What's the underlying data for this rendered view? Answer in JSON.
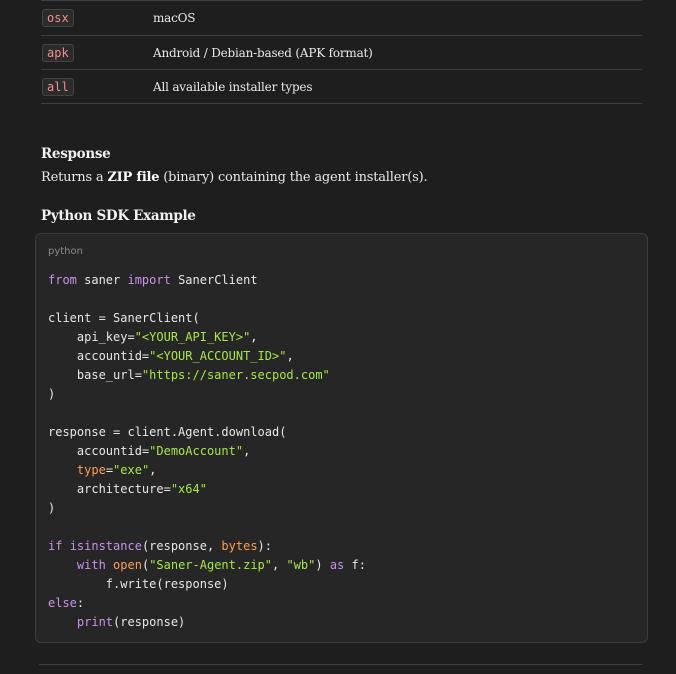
{
  "table": {
    "rows": [
      {
        "code": "osx",
        "desc": "macOS"
      },
      {
        "code": "apk",
        "desc": "Android / Debian-based (APK format)"
      },
      {
        "code": "all",
        "desc": "All available installer types"
      }
    ]
  },
  "response": {
    "heading": "Response",
    "text_before": "Returns a ",
    "text_bold": "ZIP file",
    "text_after": " (binary) containing the agent installer(s)."
  },
  "example": {
    "heading": "Python SDK Example",
    "language": "python",
    "lines": [
      [
        [
          "kw",
          "from"
        ],
        [
          "",
          " saner "
        ],
        [
          "kw",
          "import"
        ],
        [
          "",
          " SanerClient"
        ]
      ],
      [],
      [
        [
          "",
          "client = SanerClient("
        ]
      ],
      [
        [
          "",
          "    api_key="
        ],
        [
          "str",
          "\"<YOUR_API_KEY>\""
        ],
        [
          "",
          ","
        ]
      ],
      [
        [
          "",
          "    accountid="
        ],
        [
          "str",
          "\"<YOUR_ACCOUNT_ID>\""
        ],
        [
          "",
          ","
        ]
      ],
      [
        [
          "",
          "    base_url="
        ],
        [
          "str",
          "\"https://saner.secpod.com\""
        ]
      ],
      [
        [
          "",
          ")"
        ]
      ],
      [],
      [
        [
          "",
          "response = client.Agent.download("
        ]
      ],
      [
        [
          "",
          "    accountid="
        ],
        [
          "str",
          "\"DemoAccount\""
        ],
        [
          "",
          ","
        ]
      ],
      [
        [
          "",
          "    "
        ],
        [
          "param",
          "type"
        ],
        [
          "",
          "="
        ],
        [
          "str",
          "\"exe\""
        ],
        [
          "",
          ","
        ]
      ],
      [
        [
          "",
          "    architecture="
        ],
        [
          "str",
          "\"x64\""
        ]
      ],
      [
        [
          "",
          ")"
        ]
      ],
      [],
      [
        [
          "kw",
          "if"
        ],
        [
          "",
          " "
        ],
        [
          "kw",
          "isinstance"
        ],
        [
          "",
          "(response, "
        ],
        [
          "bi",
          "bytes"
        ],
        [
          "",
          "):"
        ]
      ],
      [
        [
          "",
          "    "
        ],
        [
          "kw",
          "with"
        ],
        [
          "",
          " "
        ],
        [
          "bi",
          "open"
        ],
        [
          "",
          "("
        ],
        [
          "str",
          "\"Saner-Agent.zip\""
        ],
        [
          "",
          ", "
        ],
        [
          "str",
          "\"wb\""
        ],
        [
          "",
          ") "
        ],
        [
          "kw",
          "as"
        ],
        [
          "",
          " f:"
        ]
      ],
      [
        [
          "",
          "        f.write(response)"
        ]
      ],
      [
        [
          "kw",
          "else"
        ],
        [
          "",
          ":"
        ]
      ],
      [
        [
          "",
          "    "
        ],
        [
          "kw",
          "print"
        ],
        [
          "",
          "(response)"
        ]
      ]
    ]
  }
}
